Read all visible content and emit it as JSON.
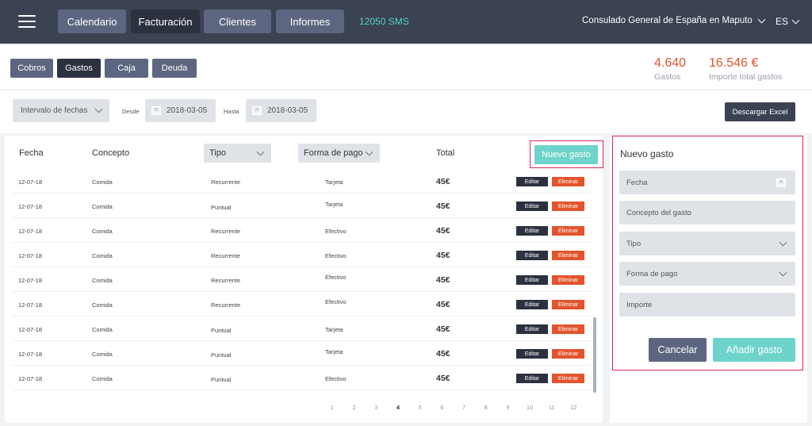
{
  "topnav": {
    "items": [
      {
        "label": "Calendario"
      },
      {
        "label": "Facturación"
      },
      {
        "label": "Clientes"
      },
      {
        "label": "Informes"
      }
    ],
    "sms": "12050 SMS",
    "consulate": "Consulado General de España en Maputo",
    "lang": "ES"
  },
  "tabs": [
    {
      "label": "Cobros"
    },
    {
      "label": "Gastos"
    },
    {
      "label": "Caja"
    },
    {
      "label": "Deuda"
    }
  ],
  "stats": {
    "gastos_value": "4.640",
    "gastos_label": "Gastos",
    "importe_value": "16.546 €",
    "importe_label": "Importe total gastos"
  },
  "filters": {
    "interval_label": "Intervalo de fechas",
    "desde_label": "Desde",
    "desde_value": "2018-03-05",
    "hasta_label": "Hasta",
    "hasta_value": "2018-03-05",
    "calendar_icon_text": "25",
    "excel_button": "Descargar Excel"
  },
  "table": {
    "headers": {
      "fecha": "Fecha",
      "concepto": "Concepto",
      "tipo": "Tipo",
      "forma_pago": "Forma de pago",
      "total": "Total"
    },
    "new_button": "Nuevo gasto",
    "edit_label": "Editar",
    "delete_label": "Eliminar",
    "rows": [
      {
        "fecha": "12-07-18",
        "concepto": "Comida",
        "tipo": "Recurrente",
        "forma": "Tarjeta",
        "total": "45€"
      },
      {
        "fecha": "12-07-18",
        "concepto": "Comida",
        "tipo": "Puntual",
        "forma": "Tarjeta",
        "total": "45€"
      },
      {
        "fecha": "12-07-18",
        "concepto": "Comida",
        "tipo": "Recurrente",
        "forma": "Efectivo",
        "total": "45€"
      },
      {
        "fecha": "12-07-18",
        "concepto": "Comida",
        "tipo": "Recurrente",
        "forma": "Efectivo",
        "total": "45€"
      },
      {
        "fecha": "12-07-18",
        "concepto": "Comida",
        "tipo": "Recurrente",
        "forma": "Efectivo",
        "total": "45€"
      },
      {
        "fecha": "12-07-18",
        "concepto": "Comida",
        "tipo": "Recurrente",
        "forma": "Efectivo",
        "total": "45€"
      },
      {
        "fecha": "12-07-18",
        "concepto": "Comida",
        "tipo": "Puntual",
        "forma": "Tarjeta",
        "total": "45€"
      },
      {
        "fecha": "12-07-18",
        "concepto": "Comida",
        "tipo": "Puntual",
        "forma": "Tarjeta",
        "total": "45€"
      },
      {
        "fecha": "12-07-18",
        "concepto": "Comida",
        "tipo": "Puntual",
        "forma": "Efectivo",
        "total": "45€"
      }
    ]
  },
  "pagination": {
    "pages": [
      "1",
      "2",
      "3",
      "4",
      "5",
      "6",
      "7",
      "8",
      "9",
      "10",
      "11",
      "12"
    ],
    "current": "4"
  },
  "form": {
    "title": "Nuevo gasto",
    "fecha_placeholder": "Fecha",
    "calendar_icon_text": "25",
    "concepto_placeholder": "Concepto del gasto",
    "tipo_placeholder": "Tipo",
    "forma_placeholder": "Forma de pago",
    "importe_placeholder": "Importe",
    "cancel_label": "Cancelar",
    "add_label": "Añadir gasto"
  },
  "colors": {
    "topbar": "#3b4252",
    "accent_teal": "#6ed3cb",
    "danger": "#e2542d",
    "highlight": "#e0245e"
  }
}
